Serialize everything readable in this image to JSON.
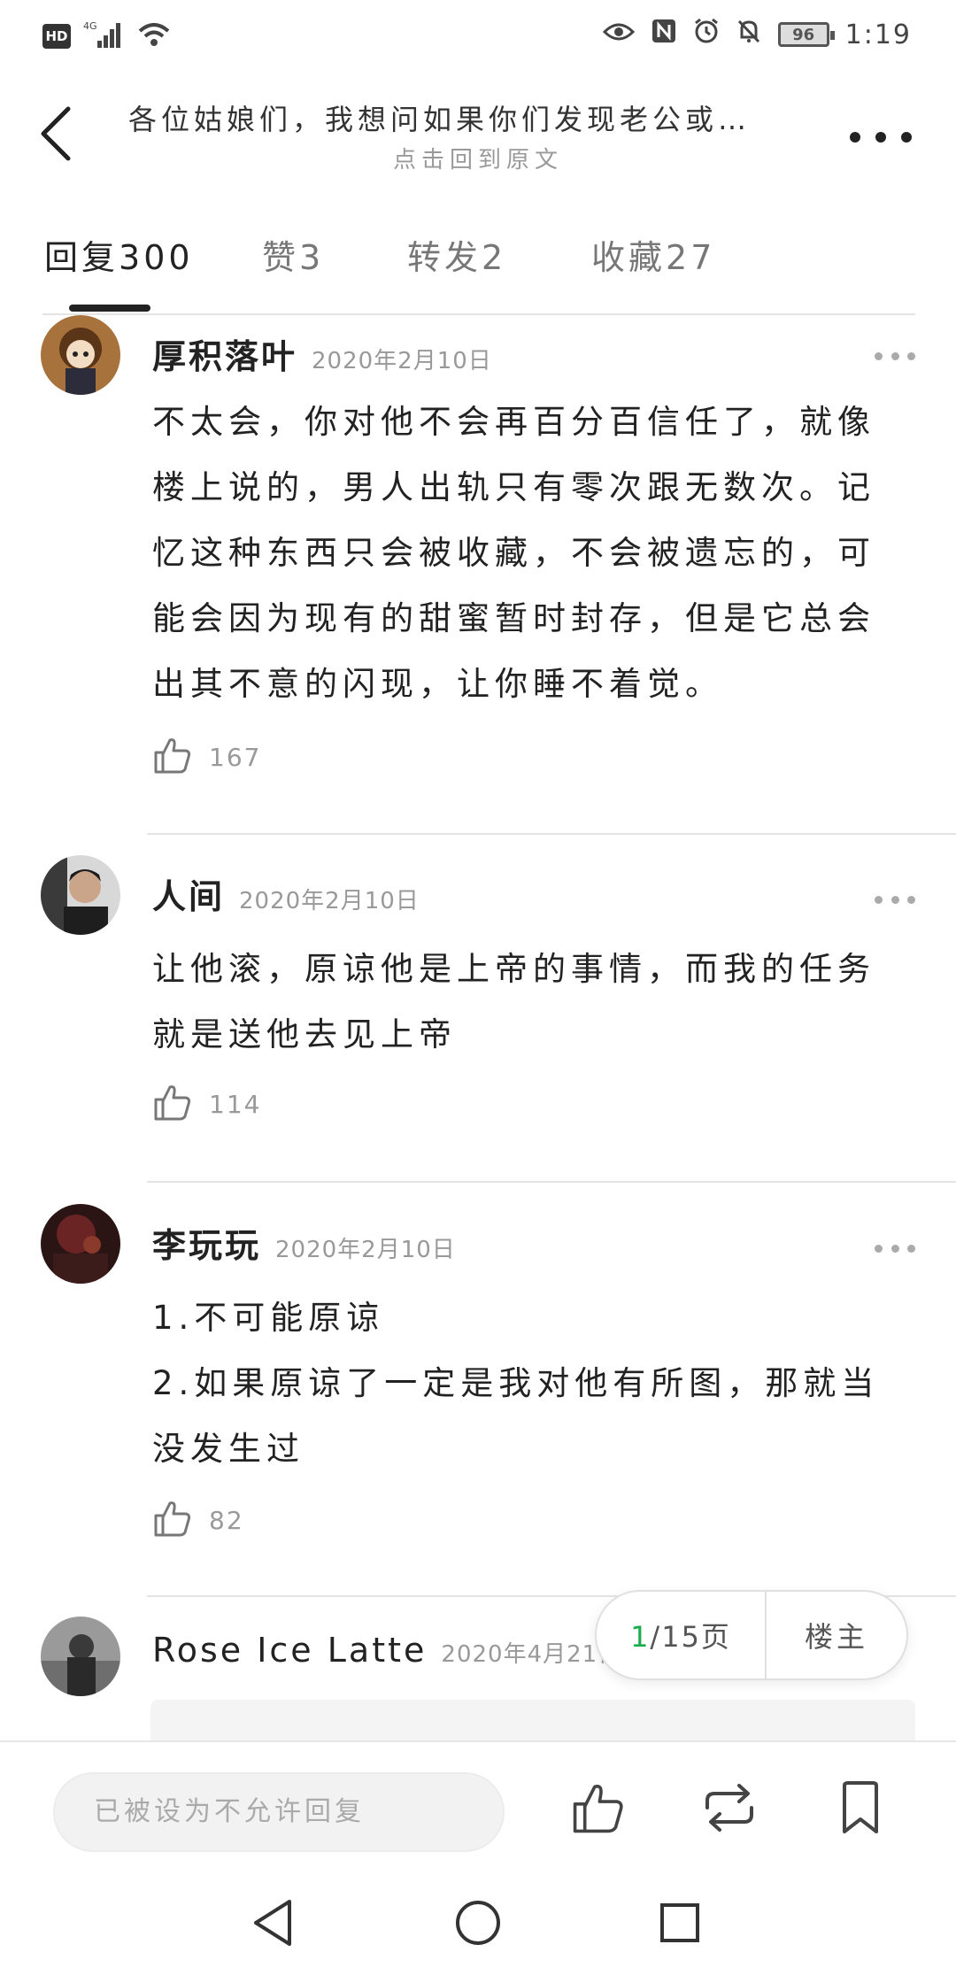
{
  "status_bar": {
    "hd": "HD",
    "network": "4G",
    "battery": "96",
    "time": "1:19"
  },
  "header": {
    "title": "各位姑娘们，我想问如果你们发现老公或…",
    "subtitle": "点击回到原文"
  },
  "tabs": [
    {
      "label": "回复",
      "count": "300"
    },
    {
      "label": "赞",
      "count": "3"
    },
    {
      "label": "转发",
      "count": "2"
    },
    {
      "label": "收藏",
      "count": "27"
    }
  ],
  "posts": [
    {
      "author": "厚积落叶",
      "date": "2020年2月10日",
      "lines": [
        "不太会，你对他不会再百分百信任了，就像",
        "楼上说的，男人出轨只有零次跟无数次。记",
        "忆这种东西只会被收藏，不会被遗忘的，可",
        "能会因为现有的甜蜜暂时封存，但是它总会",
        "出其不意的闪现，让你睡不着觉。"
      ],
      "likes": "167"
    },
    {
      "author": "人间",
      "date": "2020年2月10日",
      "lines": [
        "让他滚，原谅他是上帝的事情，而我的任务",
        "就是送他去见上帝"
      ],
      "likes": "114"
    },
    {
      "author": "李玩玩",
      "date": "2020年2月10日",
      "lines": [
        "1.不可能原谅",
        "2.如果原谅了一定是我对他有所图，那就当",
        "没发生过"
      ],
      "likes": "82"
    },
    {
      "author": "Rose Ice Latte",
      "date": "2020年4月21日"
    }
  ],
  "pager": {
    "current": "1",
    "total": "/15页",
    "owner_label": "楼主"
  },
  "bottom_bar": {
    "reply_placeholder": "已被设为不允许回复"
  },
  "colors": {
    "accent_green": "#1aab4b",
    "text": "#222222",
    "muted": "#999999"
  },
  "icons": {
    "back": "chevron-left-icon",
    "more": "more-horizontal-icon",
    "like": "thumbs-up-icon",
    "repost": "repost-icon",
    "bookmark": "bookmark-icon"
  }
}
